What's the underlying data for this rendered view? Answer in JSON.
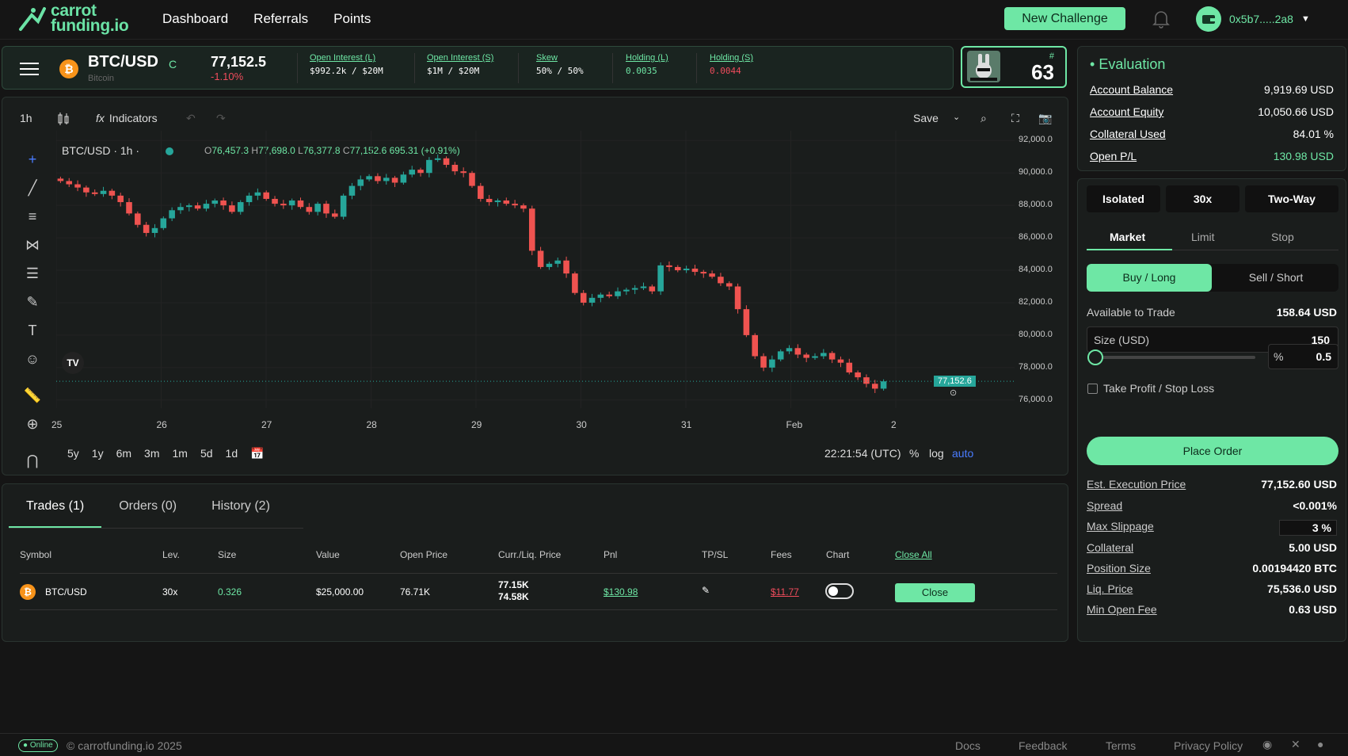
{
  "app": {
    "logo_line1": "carrot",
    "logo_line2": "funding.io",
    "nav": [
      "Dashboard",
      "Referrals",
      "Points"
    ],
    "new_challenge": "New Challenge",
    "wallet": "0x5b7.....2a8"
  },
  "ticker": {
    "pair": "BTC/USD",
    "pair_tag": "C",
    "asset_name": "Bitcoin",
    "price": "77,152.5",
    "change": "-1.10%",
    "stats": [
      {
        "label": "Open Interest (L)",
        "value": "$992.2k / $20M"
      },
      {
        "label": "Open Interest (S)",
        "value": "$1M / $20M"
      },
      {
        "label": "Skew",
        "value": "50% / 50%"
      },
      {
        "label": "Holding (L)",
        "value": "0.0035"
      },
      {
        "label": "Holding (S)",
        "value": "0.0044"
      }
    ]
  },
  "rank": {
    "hash": "#",
    "value": "63"
  },
  "evaluation": {
    "title": "Evaluation",
    "rows": [
      {
        "label": "Account Balance",
        "value": "9,919.69 USD"
      },
      {
        "label": "Account Equity",
        "value": "10,050.66 USD"
      },
      {
        "label": "Collateral Used",
        "value": "84.01 %"
      },
      {
        "label": "Open P/L",
        "value": "130.98 USD"
      }
    ],
    "pl_color": "#6ee7a5"
  },
  "chart_toolbar": {
    "interval": "1h",
    "indicators": "Indicators",
    "save": "Save"
  },
  "chart_legend": {
    "symbol": "BTC/USD · 1h ·",
    "o_label": "O",
    "o": "76,457.3",
    "h_label": "H",
    "h": "77,698.0",
    "l_label": "L",
    "l": "76,377.8",
    "c_label": "C",
    "c": "77,152.6",
    "chg": "695.31 (+0.91%)"
  },
  "chart_data": {
    "type": "candlestick",
    "y_ticks": [
      "92,000.0",
      "90,000.0",
      "88,000.0",
      "86,000.0",
      "84,000.0",
      "82,000.0",
      "80,000.0",
      "78,000.0",
      "76,000.0"
    ],
    "ylim": [
      75500,
      92600
    ],
    "x_ticks": [
      "25",
      "26",
      "27",
      "28",
      "29",
      "30",
      "31",
      "Feb",
      "2"
    ],
    "last_price": "77,152.6",
    "up_color": "#26a69a",
    "down_color": "#ef5350",
    "close_series": [
      89500,
      89300,
      89100,
      88800,
      88700,
      88900,
      88600,
      88200,
      87500,
      86800,
      86300,
      86600,
      87200,
      87700,
      87900,
      88000,
      87800,
      88100,
      88300,
      88000,
      87600,
      88200,
      88600,
      88800,
      88400,
      88100,
      88000,
      88300,
      87900,
      87600,
      88100,
      87500,
      87300,
      88600,
      89200,
      89600,
      89800,
      89500,
      89700,
      89400,
      89900,
      90200,
      90000,
      90800,
      90900,
      90500,
      90100,
      90000,
      89200,
      88400,
      88200,
      88300,
      88100,
      88000,
      87800,
      85200,
      84200,
      84400,
      84600,
      83800,
      82600,
      82000,
      82300,
      82500,
      82400,
      82700,
      82800,
      82900,
      83000,
      82700,
      84300,
      84200,
      84000,
      84100,
      83900,
      83800,
      83600,
      83200,
      83000,
      81600,
      80000,
      78700,
      78000,
      78500,
      79000,
      79200,
      78800,
      78600,
      78700,
      78900,
      78500,
      78300,
      77700,
      77400,
      77000,
      76700,
      77152
    ]
  },
  "chart_bottom": {
    "ranges": [
      "5y",
      "1y",
      "6m",
      "3m",
      "1m",
      "5d",
      "1d"
    ],
    "time": "22:21:54 (UTC)",
    "pct": "%",
    "log": "log",
    "auto": "auto"
  },
  "trades": {
    "tabs": [
      "Trades (1)",
      "Orders (0)",
      "History (2)"
    ],
    "headers": [
      "Symbol",
      "Lev.",
      "Size",
      "Value",
      "Open Price",
      "Curr./Liq. Price",
      "Pnl",
      "TP/SL",
      "Fees",
      "Chart",
      "Close All"
    ],
    "row": {
      "symbol": "BTC/USD",
      "lev": "30x",
      "size": "0.326",
      "value": "$25,000.00",
      "open_price": "76.71K",
      "curr_price": "77.15K",
      "liq_price": "74.58K",
      "pnl": "$130.98",
      "fees": "$11.77",
      "close": "Close"
    }
  },
  "order": {
    "margin_mode": "Isolated",
    "leverage": "30x",
    "position_mode": "Two-Way",
    "tabs": [
      "Market",
      "Limit",
      "Stop"
    ],
    "buy": "Buy / Long",
    "sell": "Sell / Short",
    "available_label": "Available to Trade",
    "available_value": "158.64 USD",
    "size_label": "Size (USD)",
    "size_value": "150",
    "slider_fraction": 0,
    "pct_symbol": "%",
    "pct_value": "0.5",
    "tpsl": "Take Profit / Stop Loss",
    "place": "Place Order",
    "details": [
      {
        "label": "Est. Execution Price",
        "value": "77,152.60 USD"
      },
      {
        "label": "Spread",
        "value": "<0.001%"
      },
      {
        "label": "Max Slippage",
        "value": "3 %"
      },
      {
        "label": "Collateral",
        "value": "5.00 USD"
      },
      {
        "label": "Position Size",
        "value": "0.00194420 BTC"
      },
      {
        "label": "Liq. Price",
        "value": "75,536.0 USD"
      },
      {
        "label": "Min Open Fee",
        "value": "0.63 USD"
      }
    ]
  },
  "footer": {
    "status": "Online",
    "copyright": "© carrotfunding.io 2025",
    "links": [
      "Docs",
      "Feedback",
      "Terms",
      "Privacy Policy"
    ]
  }
}
